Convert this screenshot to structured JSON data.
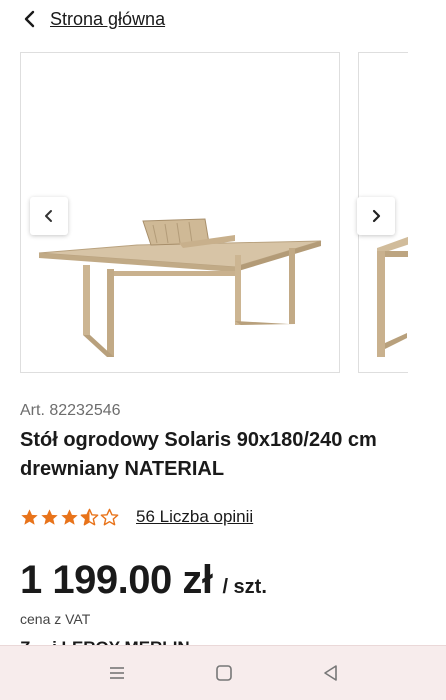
{
  "header": {
    "back_label": "Strona główna"
  },
  "product": {
    "article": "Art. 82232546",
    "title": "Stół ogrodowy Solaris 90x180/240 cm drewniany NATERIAL",
    "rating": 3.5,
    "rating_max": 5,
    "reviews_label": "56 Liczba opinii",
    "price": "1 199.00 zł",
    "unit": "/ szt.",
    "vat_note": "cena z VAT",
    "partial_line": "Z…   j       LEROY MERLIN"
  },
  "colors": {
    "star": "#e8731a",
    "text": "#1a1a1a",
    "muted": "#6d6d6d",
    "nav_bg": "#f7ecec"
  },
  "icons": {
    "back": "chevron-left-icon",
    "prev": "chevron-left-icon",
    "next": "chevron-right-icon",
    "recents": "recents-icon",
    "home": "home-icon",
    "back_nav": "back-triangle-icon"
  }
}
